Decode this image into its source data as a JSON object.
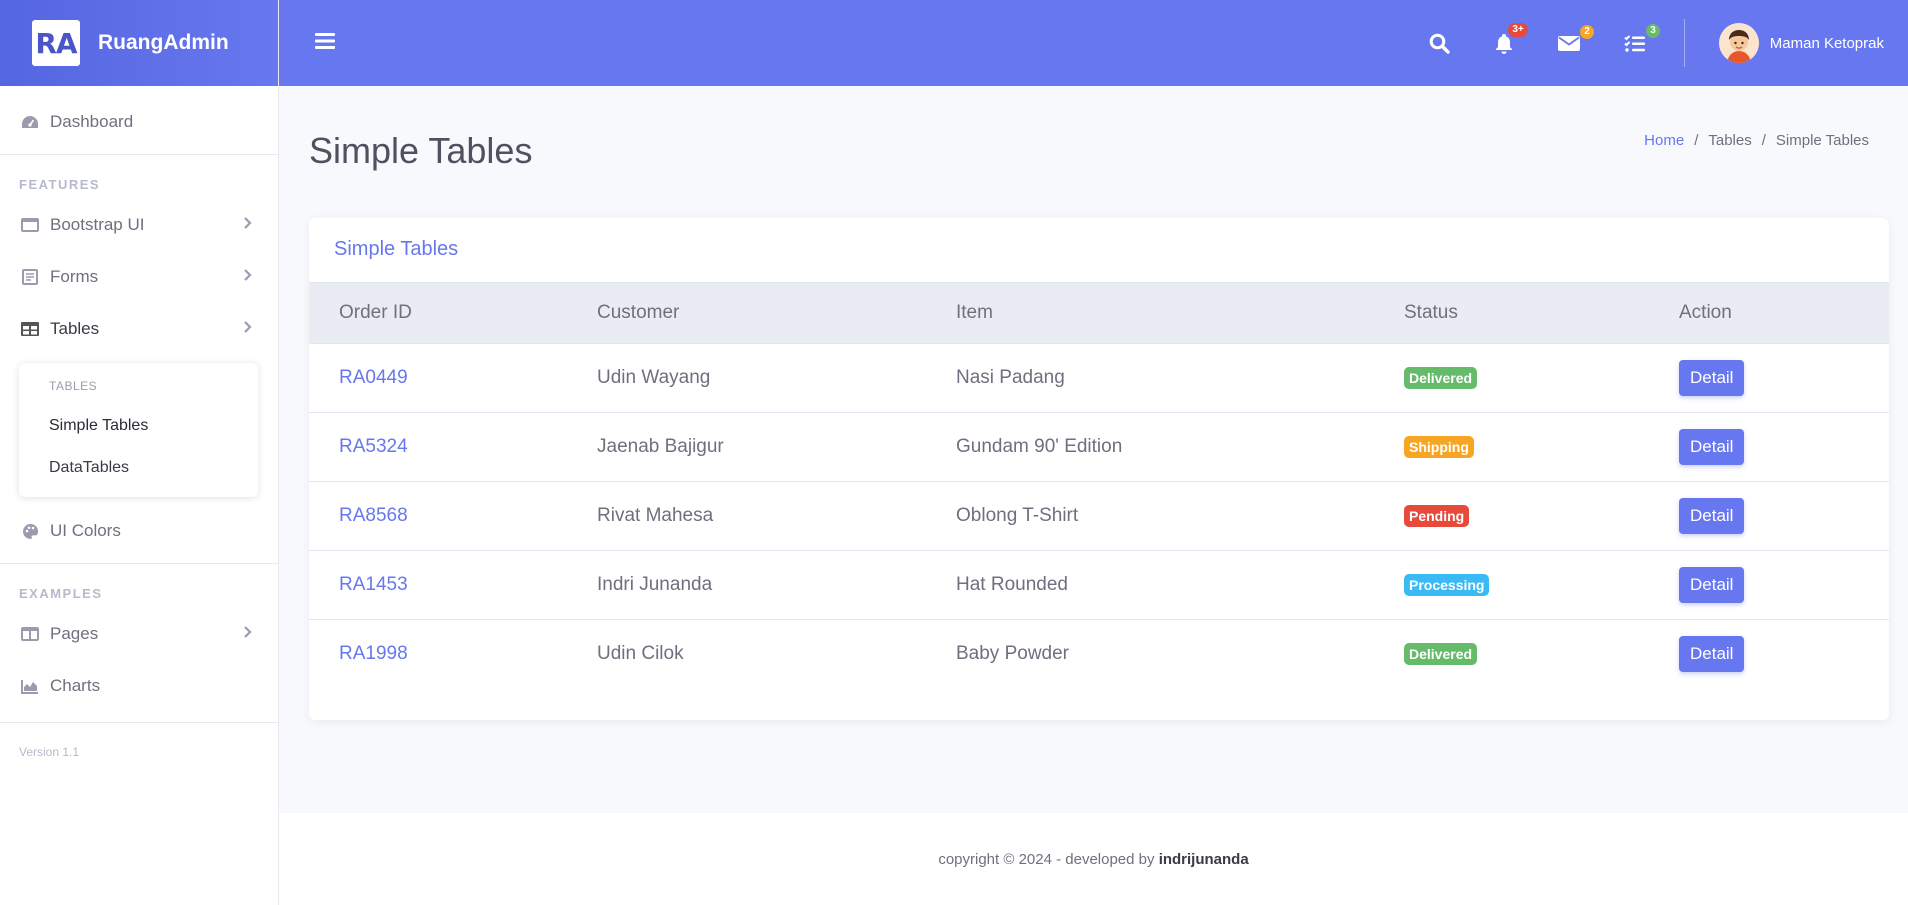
{
  "brand": {
    "logo_text": "RA",
    "name": "RuangAdmin"
  },
  "sidebar": {
    "dashboard": "Dashboard",
    "features_heading": "FEATURES",
    "items": [
      {
        "label": "Bootstrap UI",
        "icon": "window-icon"
      },
      {
        "label": "Forms",
        "icon": "form-icon"
      },
      {
        "label": "Tables",
        "icon": "table-icon"
      }
    ],
    "submenu": {
      "heading": "TABLES",
      "items": [
        "Simple Tables",
        "DataTables"
      ]
    },
    "ui_colors": "UI Colors",
    "examples_heading": "EXAMPLES",
    "pages": "Pages",
    "charts": "Charts",
    "version": "Version 1.1"
  },
  "topbar": {
    "alerts_count": "3+",
    "messages_count": "2",
    "tasks_count": "3",
    "user_name": "Maman Ketoprak",
    "colors": {
      "primary": "#6777ef",
      "danger": "#e74a3b",
      "warning": "#f6a623",
      "success": "#66bb6a"
    }
  },
  "page": {
    "title": "Simple Tables",
    "breadcrumb": [
      "Home",
      "Tables",
      "Simple Tables"
    ]
  },
  "card": {
    "title": "Simple Tables",
    "columns": [
      "Order ID",
      "Customer",
      "Item",
      "Status",
      "Action"
    ],
    "rows": [
      {
        "id": "RA0449",
        "customer": "Udin Wayang",
        "item": "Nasi Padang",
        "status": "Delivered",
        "status_color": "#66bb6a",
        "action": "Detail"
      },
      {
        "id": "RA5324",
        "customer": "Jaenab Bajigur",
        "item": "Gundam 90' Edition",
        "status": "Shipping",
        "status_color": "#f6a623",
        "action": "Detail"
      },
      {
        "id": "RA8568",
        "customer": "Rivat Mahesa",
        "item": "Oblong T-Shirt",
        "status": "Pending",
        "status_color": "#e74a3b",
        "action": "Detail"
      },
      {
        "id": "RA1453",
        "customer": "Indri Junanda",
        "item": "Hat Rounded",
        "status": "Processing",
        "status_color": "#3abaf4",
        "action": "Detail"
      },
      {
        "id": "RA1998",
        "customer": "Udin Cilok",
        "item": "Baby Powder",
        "status": "Delivered",
        "status_color": "#66bb6a",
        "action": "Detail"
      }
    ]
  },
  "footer": {
    "text": "copyright © 2024 - developed by",
    "author": "indrijunanda"
  }
}
